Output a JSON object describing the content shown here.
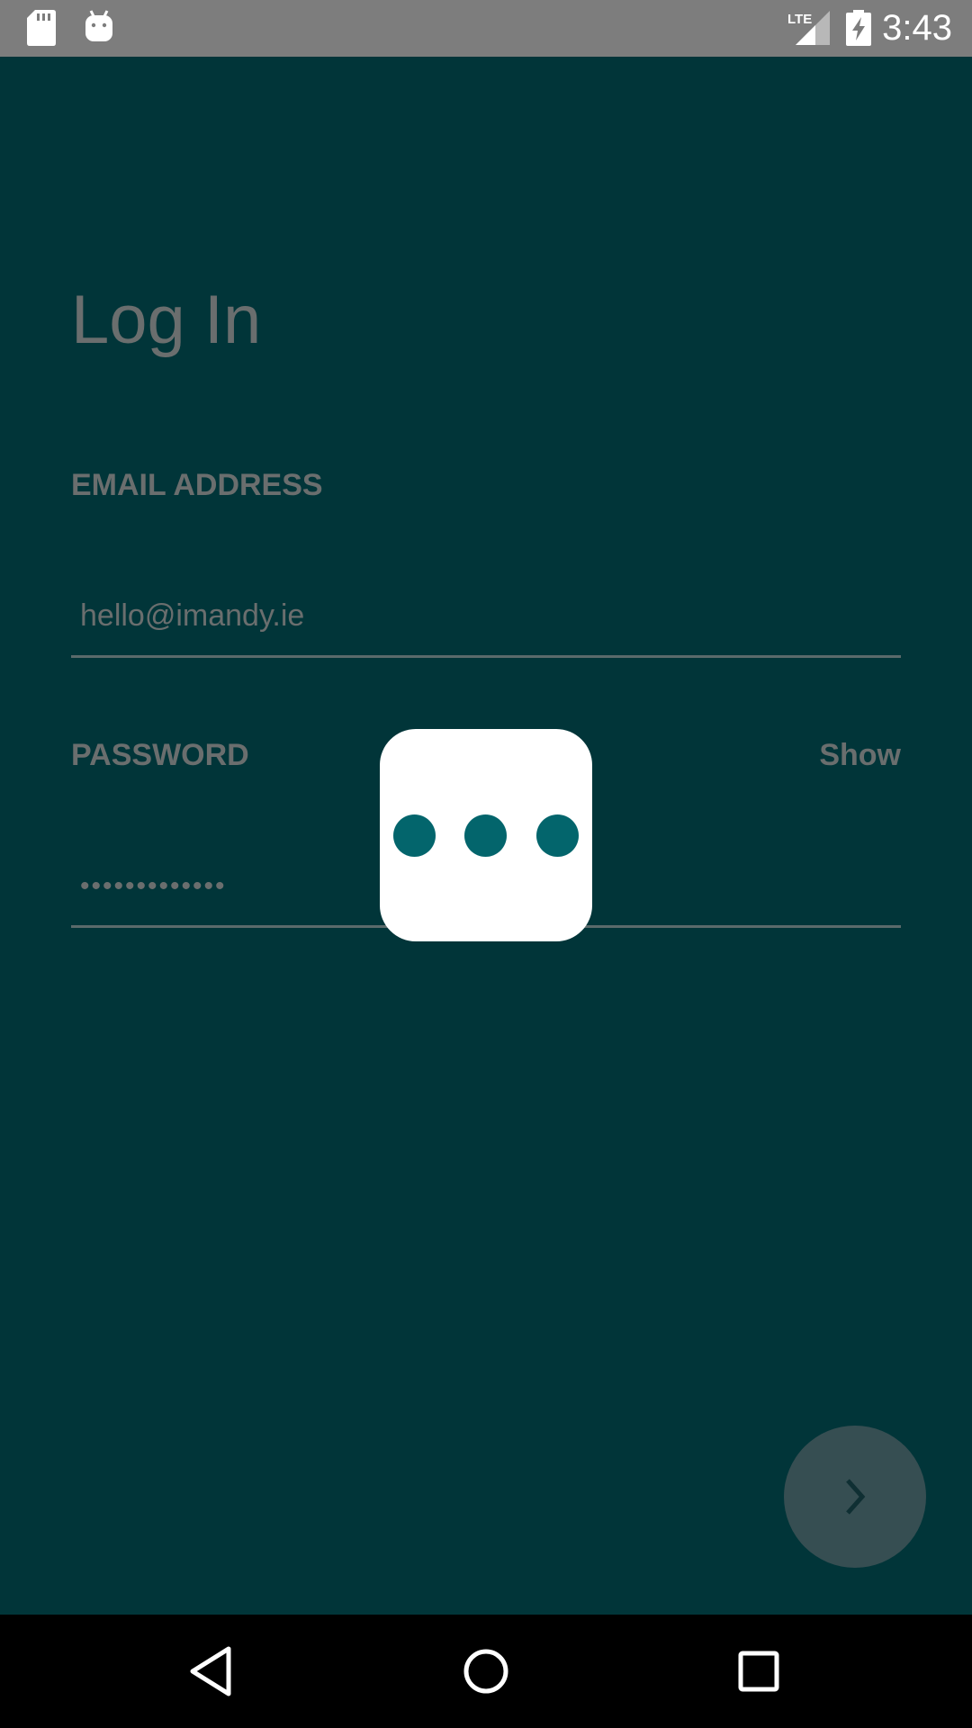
{
  "status_bar": {
    "time": "3:43",
    "network": "LTE",
    "icons": [
      "sd-card-icon",
      "android-icon",
      "lte-signal-icon",
      "battery-charging-icon"
    ]
  },
  "login": {
    "title": "Log In",
    "email_label": "EMAIL ADDRESS",
    "email_value": "hello@imandy.ie",
    "password_label": "PASSWORD",
    "password_value": "•••••••••••••",
    "show_label": "Show",
    "next_icon": "chevron-right-icon"
  },
  "loading": {
    "dot_count": 3,
    "dot_color": "#03656c"
  },
  "nav_bar": {
    "icons": [
      "back-icon",
      "home-icon",
      "recents-icon"
    ]
  },
  "colors": {
    "background": "#013539",
    "status_bar": "#7d7d7d",
    "text_dim": "#6a6e6e",
    "fab": "#364e52",
    "dialog": "#ffffff"
  }
}
